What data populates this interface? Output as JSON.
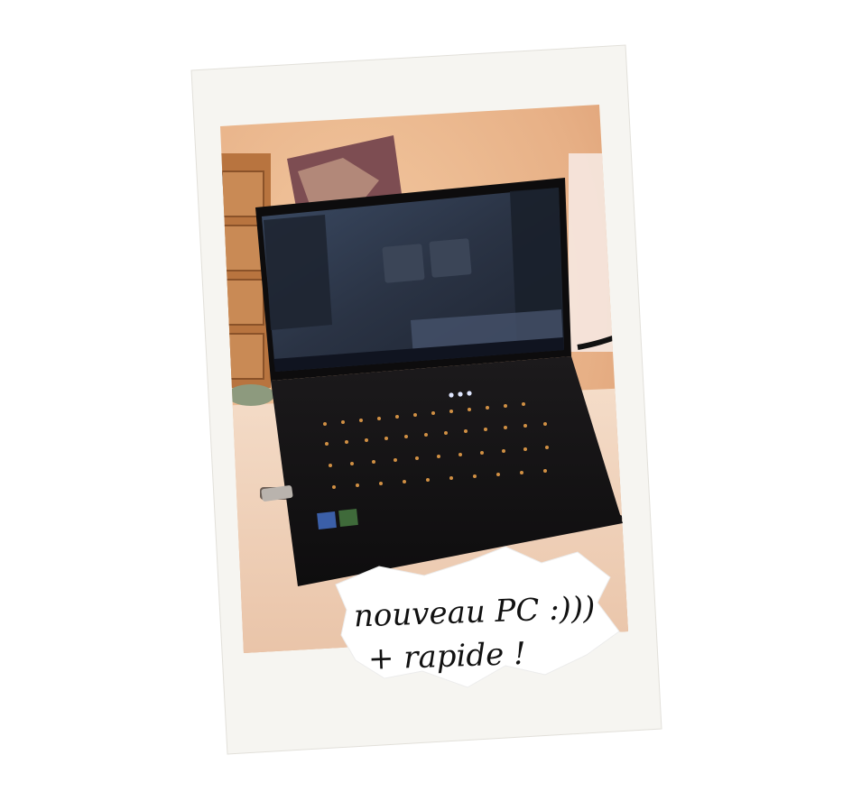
{
  "caption": {
    "line1": "nouveau PC :)))",
    "line2": "+ rapide !"
  },
  "colors": {
    "page_background": "#ffffff",
    "polaroid_frame": "#f6f5f1",
    "wall": "#e8b48c",
    "laptop_body": "#141214",
    "screen": "#2b3444",
    "key_backlight": "#f2a64c",
    "caption_paper": "#ffffff",
    "ink": "#111111"
  },
  "scene": {
    "subject": "laptop",
    "icons": [
      "polaroid-frame",
      "laptop",
      "sticker-note"
    ]
  }
}
